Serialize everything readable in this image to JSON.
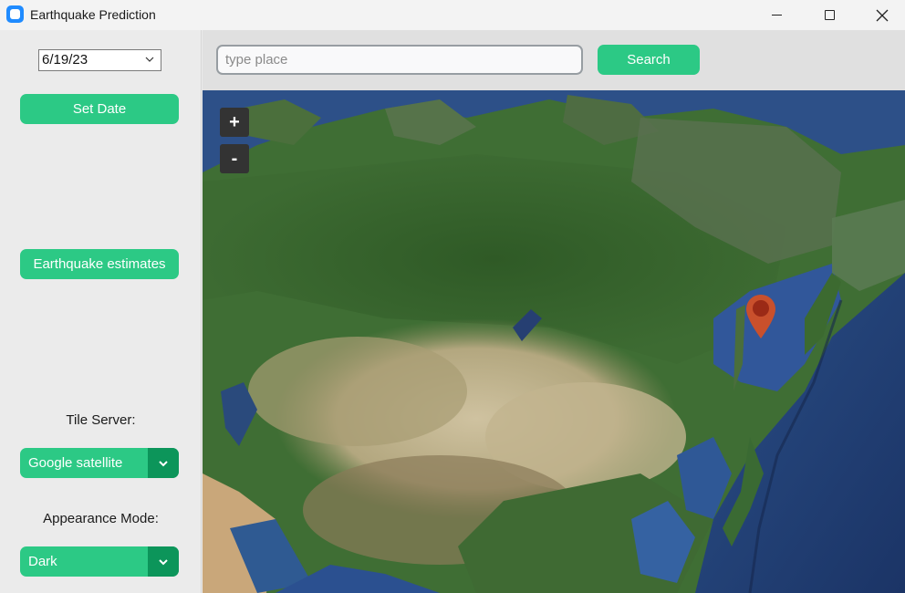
{
  "window": {
    "title": "Earthquake Prediction",
    "icon": "app-icon"
  },
  "sidebar": {
    "date_value": "6/19/23",
    "set_date_label": "Set Date",
    "estimates_label": "Earthquake estimates",
    "tile_server_label": "Tile Server:",
    "tile_server_value": "Google satellite",
    "appearance_label": "Appearance Mode:",
    "appearance_value": "Dark"
  },
  "search": {
    "placeholder": "type place",
    "button_label": "Search"
  },
  "map": {
    "zoom_in_label": "+",
    "zoom_out_label": "-",
    "marker_icon": "map-pin-icon"
  },
  "colors": {
    "accent": "#2cc985",
    "accent_dark": "#0c955a",
    "marker": "#c9502c"
  }
}
